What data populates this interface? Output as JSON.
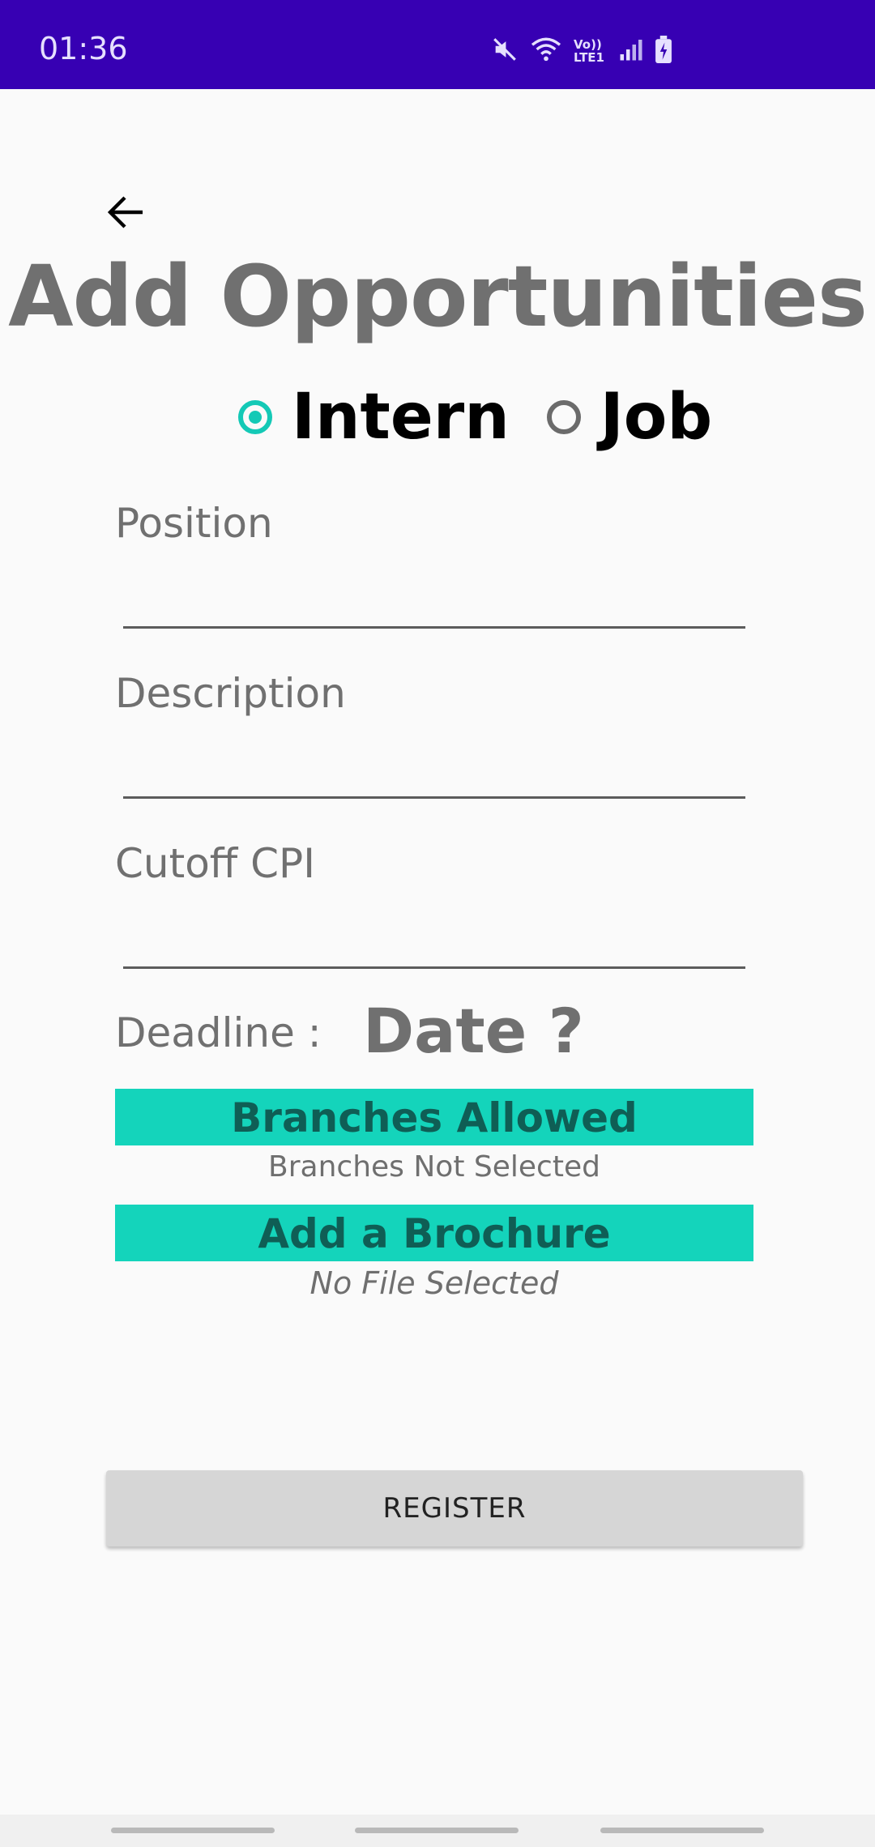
{
  "status_bar": {
    "time": "01:36",
    "network_label": "Vo)) LTE1",
    "icons": [
      "mute-icon",
      "wifi-icon",
      "volte-icon",
      "signal-icon",
      "battery-charging-icon"
    ],
    "background": "#3700b3"
  },
  "header": {
    "back_icon": "arrow-left-icon",
    "title": "Add Opportunities"
  },
  "type_selector": {
    "options": [
      {
        "label": "Intern",
        "checked": true
      },
      {
        "label": "Job",
        "checked": false
      }
    ],
    "accent": "#14c9b6"
  },
  "form": {
    "position_label": "Position",
    "description_label": "Description",
    "cutoff_label": "Cutoff CPI",
    "deadline_label": "Deadline :",
    "deadline_value": "Date ?"
  },
  "branches": {
    "button_label": "Branches Allowed",
    "status": "Branches Not Selected"
  },
  "brochure": {
    "button_label": "Add a Brochure",
    "status": "No File Selected"
  },
  "register": {
    "label": "REGISTER"
  },
  "colors": {
    "teal": "#14d4bb",
    "button_text": "#0f5e55"
  }
}
